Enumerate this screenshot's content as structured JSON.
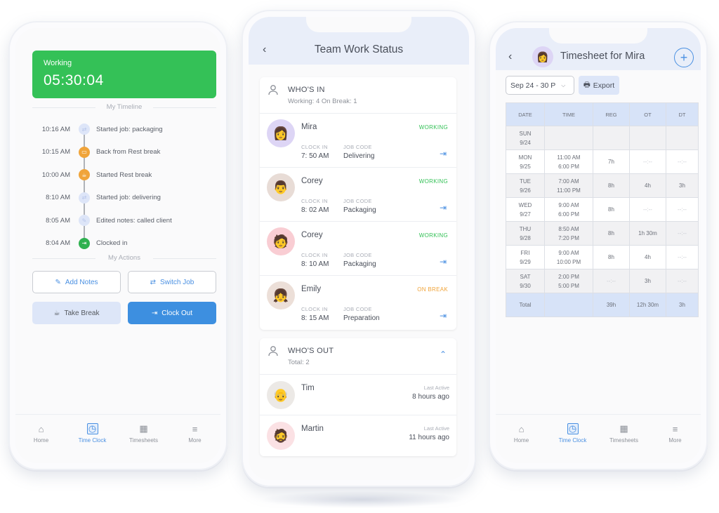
{
  "left_phone": {
    "status": {
      "label": "Working",
      "timer": "05:30:04",
      "color": "#34c157"
    },
    "timeline_heading": "My Timeline",
    "timeline": [
      {
        "time": "10:16 AM",
        "text": "Started job: packaging",
        "icon": "switch-icon",
        "color": "#dde5f8"
      },
      {
        "time": "10:15 AM",
        "text": "Back from Rest break",
        "icon": "battery-icon",
        "color": "#f0a43a"
      },
      {
        "time": "10:00 AM",
        "text": "Started Rest break",
        "icon": "coffee-icon",
        "color": "#f0a43a"
      },
      {
        "time": "8:10 AM",
        "text": "Started job: delivering",
        "icon": "switch-icon",
        "color": "#dde5f8"
      },
      {
        "time": "8:05 AM",
        "text": "Edited notes: called client",
        "icon": "pencil-icon",
        "color": "#dde5f8"
      },
      {
        "time": "8:04 AM",
        "text": "Clocked in",
        "icon": "login-icon",
        "color": "#2fb150"
      }
    ],
    "actions_heading": "My Actions",
    "actions": {
      "add_notes": "Add Notes",
      "switch_job": "Switch Job",
      "take_break": "Take Break",
      "clock_out": "Clock Out"
    },
    "nav": [
      {
        "label": "Home",
        "icon": "home-icon"
      },
      {
        "label": "Time Clock",
        "icon": "clock-icon",
        "active": true
      },
      {
        "label": "Timesheets",
        "icon": "calendar-icon"
      },
      {
        "label": "More",
        "icon": "menu-icon"
      }
    ]
  },
  "middle_phone": {
    "title": "Team Work Status",
    "whos_in": {
      "title": "WHO'S IN",
      "subtitle": "Working: 4   On Break: 1",
      "clock_in_label": "CLOCK IN",
      "job_code_label": "JOB CODE",
      "employees": [
        {
          "name": "Mira",
          "status": "WORKING",
          "status_color": "#34c157",
          "clock_in": "7: 50 AM",
          "job": "Delivering",
          "avatar_bg": "#ddd5f5",
          "avatar": "👩"
        },
        {
          "name": "Corey",
          "status": "WORKING",
          "status_color": "#34c157",
          "clock_in": "8: 02 AM",
          "job": "Packaging",
          "avatar_bg": "#e8dcd6",
          "avatar": "👨"
        },
        {
          "name": "Corey",
          "status": "WORKING",
          "status_color": "#34c157",
          "clock_in": "8: 10 AM",
          "job": "Packaging",
          "avatar_bg": "#f9cdd3",
          "avatar": "🧑"
        },
        {
          "name": "Emily",
          "status": "ON BREAK",
          "status_color": "#f0a43a",
          "clock_in": "8: 15 AM",
          "job": "Preparation",
          "avatar_bg": "#ecdfd8",
          "avatar": "👧"
        }
      ]
    },
    "whos_out": {
      "title": "WHO'S OUT",
      "subtitle": "Total: 2",
      "last_active_label": "Last Active",
      "employees": [
        {
          "name": "Tim",
          "last_active": "8 hours ago",
          "avatar_bg": "#ece9e6",
          "avatar": "👴"
        },
        {
          "name": "Martin",
          "last_active": "11 hours ago",
          "avatar_bg": "#fbe1e4",
          "avatar": "🧔"
        }
      ]
    }
  },
  "right_phone": {
    "title": "Timesheet for Mira",
    "range": "Sep 24 - 30 P",
    "export_label": "Export",
    "columns": [
      "DATE",
      "TIME",
      "REG",
      "OT",
      "DT"
    ],
    "rows": [
      {
        "day": "SUN",
        "date": "9/24",
        "in": "",
        "out": "",
        "reg": "",
        "ot": "",
        "dt": ""
      },
      {
        "day": "MON",
        "date": "9/25",
        "in": "11:00 AM",
        "out": "6:00 PM",
        "reg": "7h",
        "ot": "--:--",
        "dt": "--:--"
      },
      {
        "day": "TUE",
        "date": "9/26",
        "in": "7:00 AM",
        "out": "11:00 PM",
        "reg": "8h",
        "ot": "4h",
        "dt": "3h"
      },
      {
        "day": "WED",
        "date": "9/27",
        "in": "9:00 AM",
        "out": "6:00 PM",
        "reg": "8h",
        "ot": "--:--",
        "dt": "--:--"
      },
      {
        "day": "THU",
        "date": "9/28",
        "in": "8:50 AM",
        "out": "7:20 PM",
        "reg": "8h",
        "ot": "1h 30m",
        "dt": "--:--"
      },
      {
        "day": "FRI",
        "date": "9/29",
        "in": "9:00 AM",
        "out": "10:00 PM",
        "reg": "8h",
        "ot": "4h",
        "dt": "--:--"
      },
      {
        "day": "SAT",
        "date": "9/30",
        "in": "2:00 PM",
        "out": "5:00 PM",
        "reg": "--:--",
        "ot": "3h",
        "dt": "--:--"
      }
    ],
    "total": {
      "label": "Total",
      "reg": "39h",
      "ot": "12h 30m",
      "dt": "3h"
    },
    "nav": [
      {
        "label": "Home",
        "icon": "home-icon"
      },
      {
        "label": "Time Clock",
        "icon": "clock-icon",
        "active": true
      },
      {
        "label": "Timesheets",
        "icon": "calendar-icon"
      },
      {
        "label": "More",
        "icon": "menu-icon"
      }
    ]
  }
}
